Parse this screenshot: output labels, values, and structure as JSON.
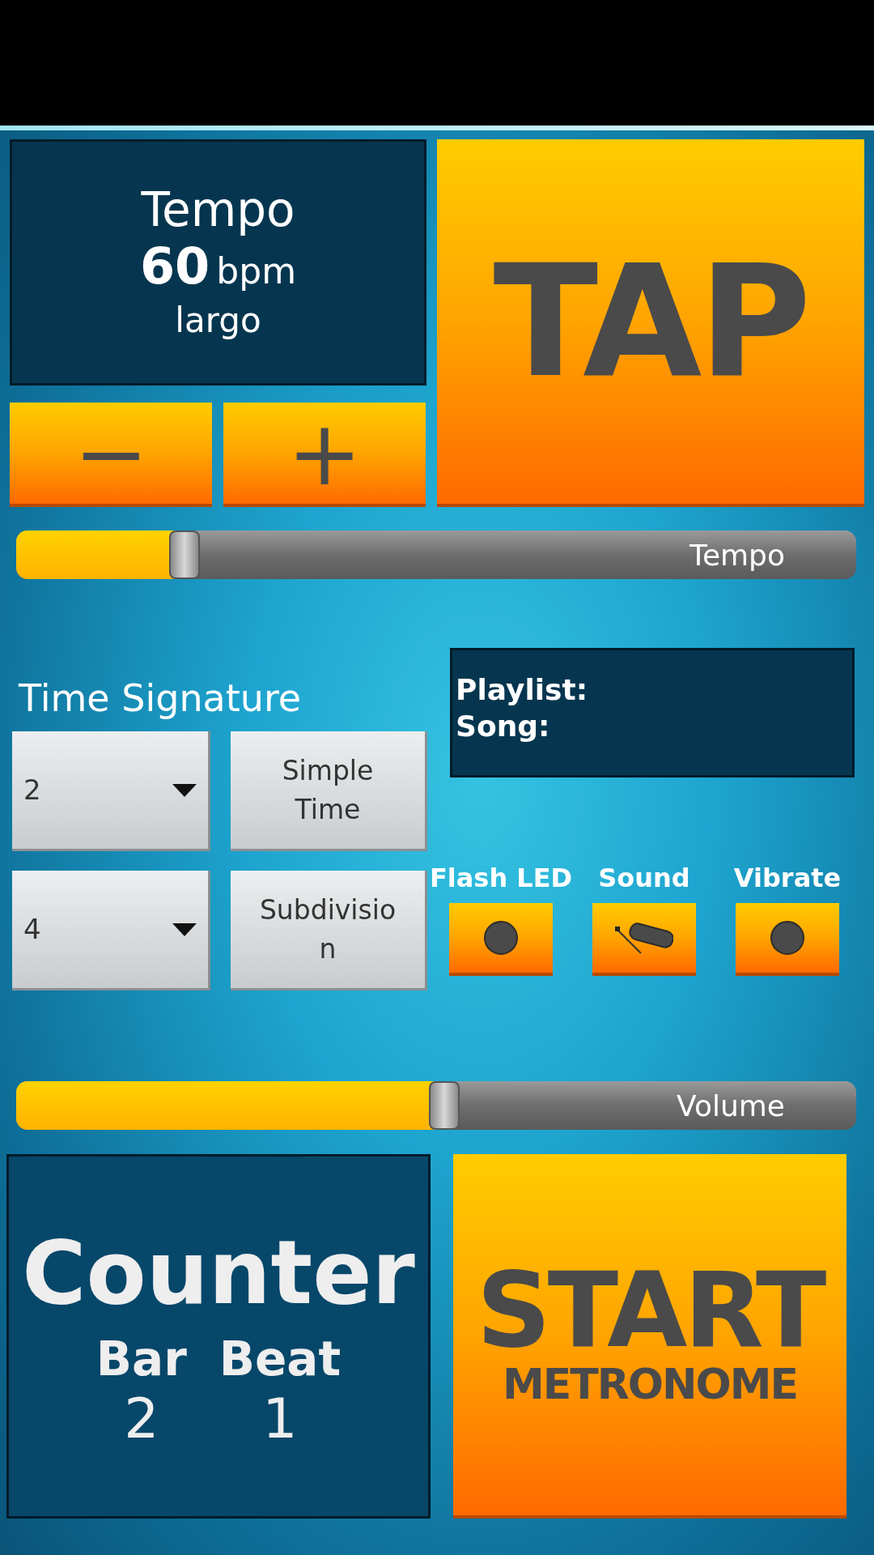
{
  "tempo": {
    "title": "Tempo",
    "value": "60",
    "unit": "bpm",
    "marking": "largo"
  },
  "step_buttons": [
    "−",
    "+"
  ],
  "tap_button": "TAP",
  "tempo_slider": {
    "label": "Tempo",
    "level": 0.2
  },
  "time_signature": {
    "label": "Time Signature",
    "selectors": [
      {
        "value": "2"
      },
      {
        "value": "4"
      }
    ],
    "buttons": [
      "Simple Time",
      "Subdivision"
    ]
  },
  "playlist": {
    "playlist_label": "Playlist:",
    "song_label": "Song:"
  },
  "outputs": [
    {
      "label": "Flash LED",
      "kind": "dot"
    },
    {
      "label": "Sound",
      "kind": "woodblock"
    },
    {
      "label": "Vibrate",
      "kind": "dot"
    }
  ],
  "volume_slider": {
    "label": "Volume",
    "level": 0.51
  },
  "counter": {
    "title": "Counter",
    "columns": [
      {
        "label": "Bar",
        "value": "2"
      },
      {
        "label": "Beat",
        "value": "1"
      }
    ]
  },
  "start_button": {
    "title": "START",
    "subtitle": "METRONOME"
  }
}
